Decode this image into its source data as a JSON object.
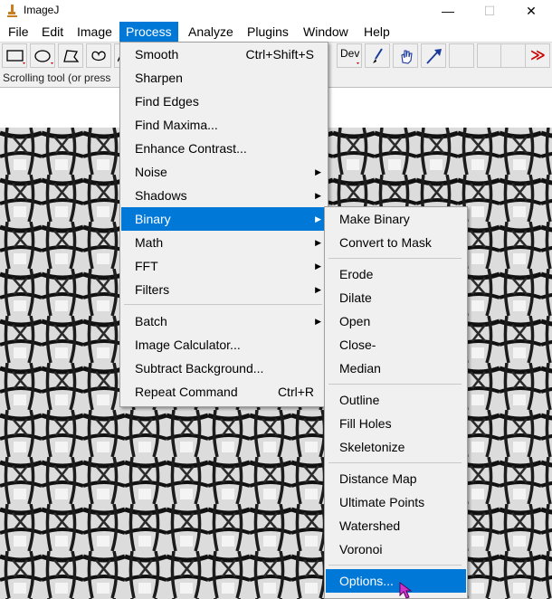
{
  "window": {
    "title": "ImageJ",
    "minimize": "—",
    "maximize": "☐",
    "close": "✕"
  },
  "menubar": [
    {
      "label": "File"
    },
    {
      "label": "Edit"
    },
    {
      "label": "Image"
    },
    {
      "label": "Process"
    },
    {
      "label": "Analyze"
    },
    {
      "label": "Plugins"
    },
    {
      "label": "Window"
    },
    {
      "label": "Help"
    }
  ],
  "toolbar": {
    "tools": [
      "rectangle-icon",
      "oval-icon",
      "polygon-icon",
      "freehand-icon",
      "line-icon",
      "dev-menu",
      "brush-icon",
      "dropper-hand-icon",
      "arrow-tool-icon",
      "more-tools-icon"
    ],
    "dev_label": "Dev",
    "more_label": "≫",
    "accent": "#cc0000"
  },
  "status": {
    "text": "Scrolling tool (or press"
  },
  "process_menu": [
    {
      "label": "Smooth",
      "shortcut": "Ctrl+Shift+S"
    },
    {
      "label": "Sharpen",
      "shortcut": ""
    },
    {
      "label": "Find Edges",
      "shortcut": ""
    },
    {
      "label": "Find Maxima...",
      "shortcut": ""
    },
    {
      "label": "Enhance Contrast...",
      "shortcut": ""
    },
    {
      "label": "Noise",
      "shortcut": "",
      "submenu": true
    },
    {
      "label": "Shadows",
      "shortcut": "",
      "submenu": true
    },
    {
      "label": "Binary",
      "shortcut": "",
      "submenu": true
    },
    {
      "label": "Math",
      "shortcut": "",
      "submenu": true
    },
    {
      "label": "FFT",
      "shortcut": "",
      "submenu": true
    },
    {
      "label": "Filters",
      "shortcut": "",
      "submenu": true
    },
    {
      "label": "Batch",
      "shortcut": "",
      "submenu": true
    },
    {
      "label": "Image Calculator...",
      "shortcut": ""
    },
    {
      "label": "Subtract Background...",
      "shortcut": ""
    },
    {
      "label": "Repeat Command",
      "shortcut": "Ctrl+R"
    }
  ],
  "binary_menu": [
    {
      "label": "Make Binary"
    },
    {
      "label": "Convert to Mask"
    },
    {
      "label": "Erode"
    },
    {
      "label": "Dilate"
    },
    {
      "label": "Open"
    },
    {
      "label": "Close-"
    },
    {
      "label": "Median"
    },
    {
      "label": "Outline"
    },
    {
      "label": "Fill Holes"
    },
    {
      "label": "Skeletonize"
    },
    {
      "label": "Distance Map"
    },
    {
      "label": "Ultimate Points"
    },
    {
      "label": "Watershed"
    },
    {
      "label": "Voronoi"
    },
    {
      "label": "Options..."
    }
  ],
  "colors": {
    "highlight": "#0078d7",
    "menu_bg": "#f0f0f0",
    "cursor": "#cc33cc"
  }
}
